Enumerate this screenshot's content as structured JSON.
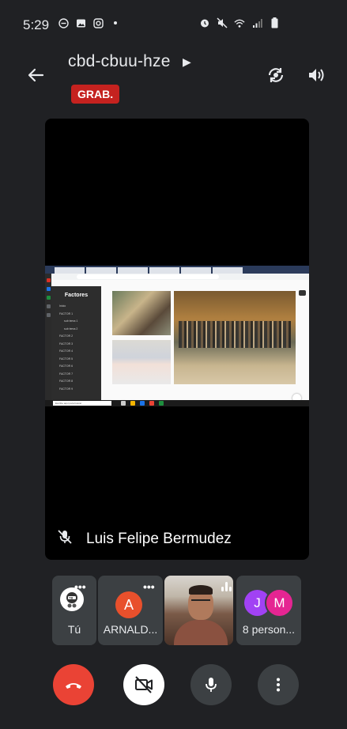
{
  "status_bar": {
    "time": "5:29"
  },
  "header": {
    "meeting_code": "cbd-cbuu-hze",
    "recording_badge": "GRAB."
  },
  "main_tile": {
    "participant_name": "Luis Felipe Bermudez",
    "shared_screen": {
      "sidebar_title": "Factores",
      "sidebar_items": [
        "Inicio",
        "FACTOR 1",
        "sub tema 1",
        "sub tema 2",
        "FACTOR 2",
        "FACTOR 3",
        "FACTOR 4",
        "FACTOR 5",
        "FACTOR 6",
        "FACTOR 7",
        "FACTOR 8",
        "FACTOR 9"
      ],
      "taskbar_search": "Escribe aquí para buscar"
    }
  },
  "participants": [
    {
      "label": "Tú"
    },
    {
      "label": "ARNALD...",
      "initial": "A"
    },
    {
      "label": ""
    },
    {
      "label": "8 person...",
      "initials": [
        "J",
        "M"
      ]
    }
  ],
  "colors": {
    "background": "#202124",
    "recording": "#c5221f",
    "end_call": "#ea4335",
    "avatar_a": "#e8502c",
    "avatar_j": "#a142f4",
    "avatar_m": "#e52592"
  }
}
